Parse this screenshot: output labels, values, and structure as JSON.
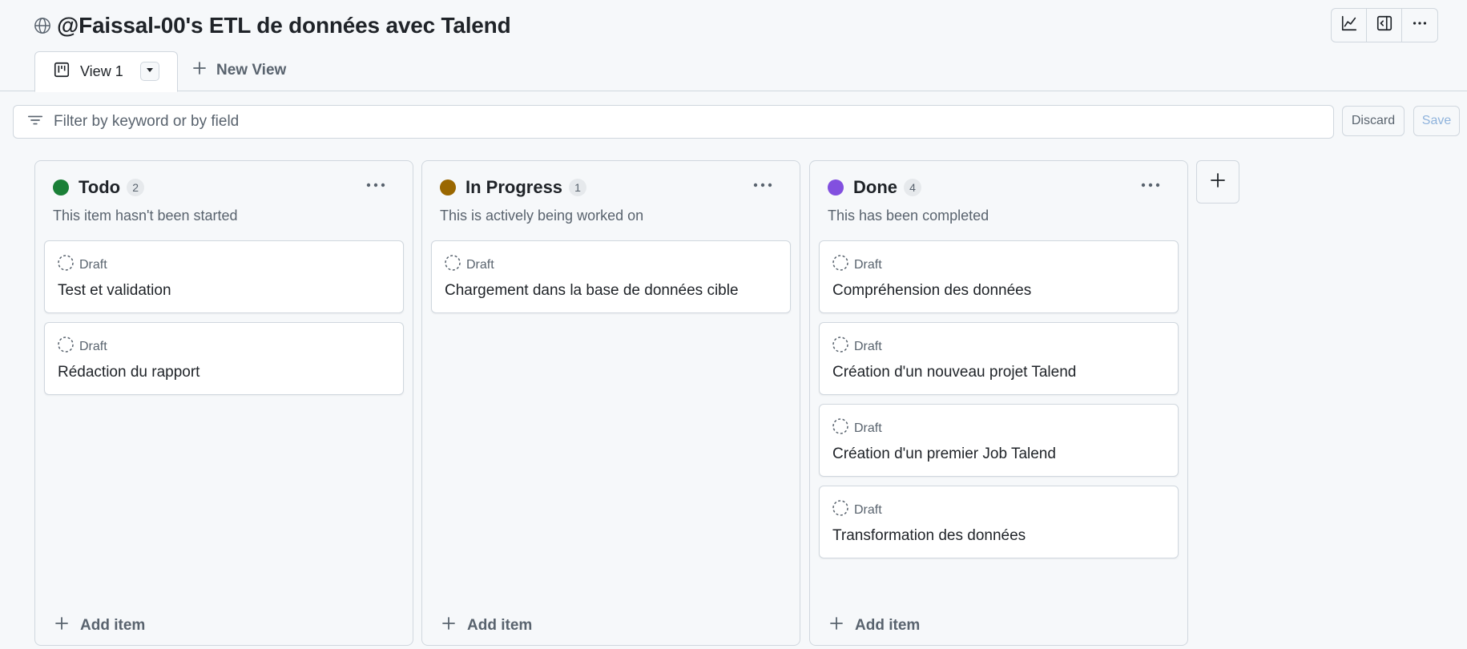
{
  "header": {
    "title": "@Faissal-00's ETL de données avec Talend",
    "actions": [
      {
        "icon": "graph-icon"
      },
      {
        "icon": "sidebar-panel-icon"
      },
      {
        "icon": "kebab-menu-icon"
      }
    ]
  },
  "tabs": {
    "active_label": "View 1",
    "new_view_label": "New View"
  },
  "filter": {
    "placeholder": "Filter by keyword or by field",
    "value": "",
    "discard_label": "Discard",
    "save_label": "Save"
  },
  "columns": [
    {
      "name": "Todo",
      "count": "2",
      "color": "#1a7f37",
      "description": "This item hasn't been started",
      "cards": [
        {
          "status": "Draft",
          "title": "Test et validation"
        },
        {
          "status": "Draft",
          "title": "Rédaction du rapport"
        }
      ],
      "add_label": "Add item"
    },
    {
      "name": "In Progress",
      "count": "1",
      "color": "#9a6700",
      "description": "This is actively being worked on",
      "cards": [
        {
          "status": "Draft",
          "title": "Chargement dans la base de données cible"
        }
      ],
      "add_label": "Add item"
    },
    {
      "name": "Done",
      "count": "4",
      "color": "#8250df",
      "description": "This has been completed",
      "cards": [
        {
          "status": "Draft",
          "title": "Compréhension des données"
        },
        {
          "status": "Draft",
          "title": "Création d'un nouveau projet Talend"
        },
        {
          "status": "Draft",
          "title": "Création d'un premier Job Talend"
        },
        {
          "status": "Draft",
          "title": "Transformation des données"
        }
      ],
      "add_label": "Add item"
    }
  ],
  "colors": {
    "accent": "#0969da",
    "border": "#d0d7de",
    "muted_text": "#59636e"
  }
}
